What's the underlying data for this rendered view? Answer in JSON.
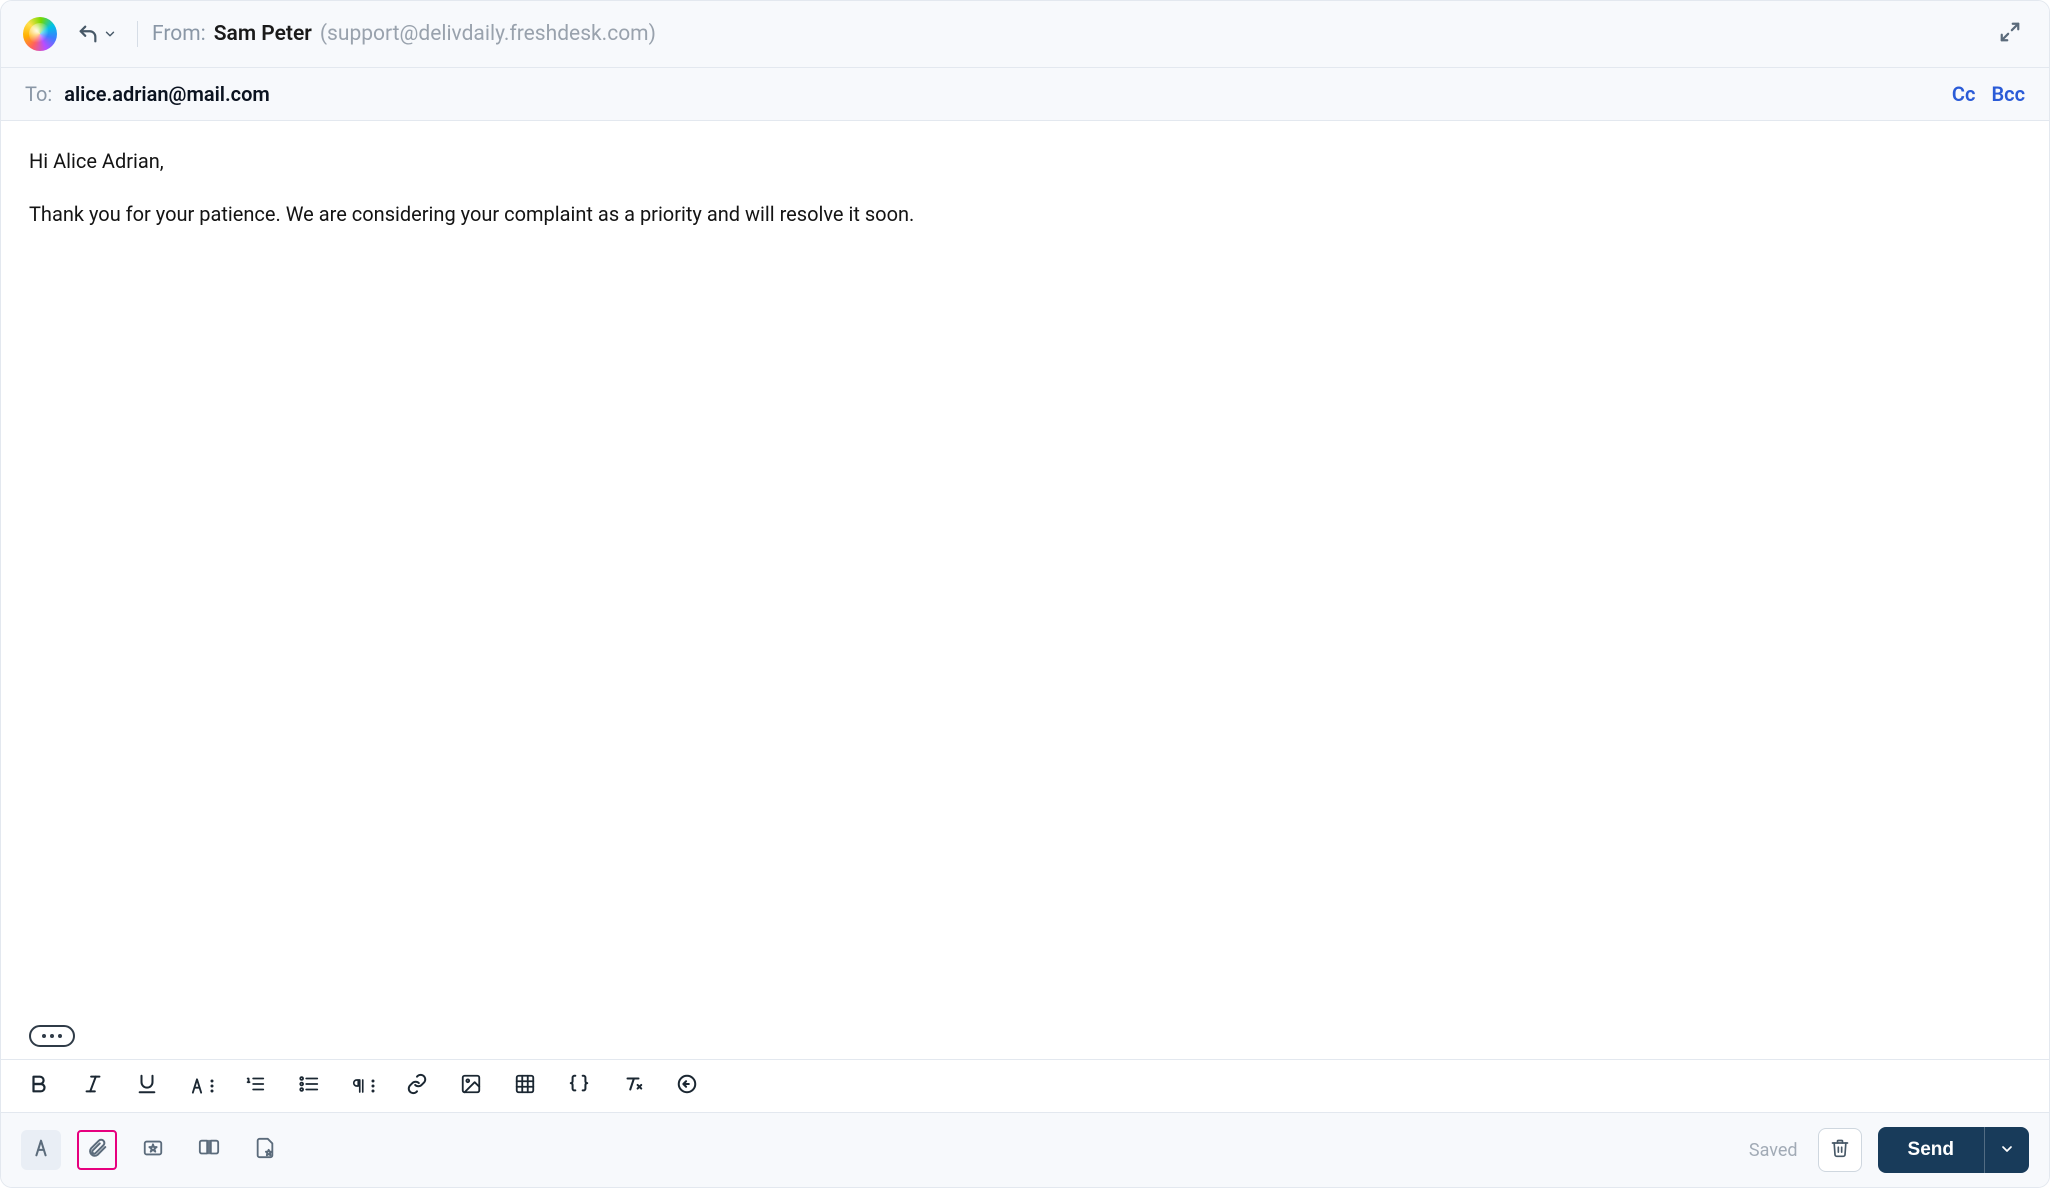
{
  "header": {
    "from_label": "From:",
    "from_name": "Sam Peter",
    "from_email": "(support@delivdaily.freshdesk.com)"
  },
  "to": {
    "label": "To:",
    "value": "alice.adrian@mail.com",
    "cc_label": "Cc",
    "bcc_label": "Bcc"
  },
  "body": {
    "greeting": "Hi Alice Adrian,",
    "paragraph": "Thank you for your patience. We are considering your complaint as a priority and will resolve it soon."
  },
  "footer": {
    "saved_label": "Saved",
    "send_label": "Send"
  },
  "icons": {
    "reply": "reply-icon",
    "chevron_down": "chevron-down-icon",
    "expand": "expand-icon",
    "bold": "bold-icon",
    "italic": "italic-icon",
    "underline": "underline-icon",
    "text_color": "text-color-icon",
    "ordered_list": "ordered-list-icon",
    "unordered_list": "unordered-list-icon",
    "paragraph_format": "paragraph-format-icon",
    "link": "link-icon",
    "image": "image-icon",
    "table": "table-icon",
    "code": "code-icon",
    "clear_formatting": "clear-formatting-icon",
    "undo": "undo-icon",
    "font_style": "font-style-icon",
    "attachment": "attachment-icon",
    "canned_response": "canned-response-icon",
    "knowledge_base": "knowledge-base-icon",
    "template": "template-icon",
    "trash": "trash-icon"
  }
}
